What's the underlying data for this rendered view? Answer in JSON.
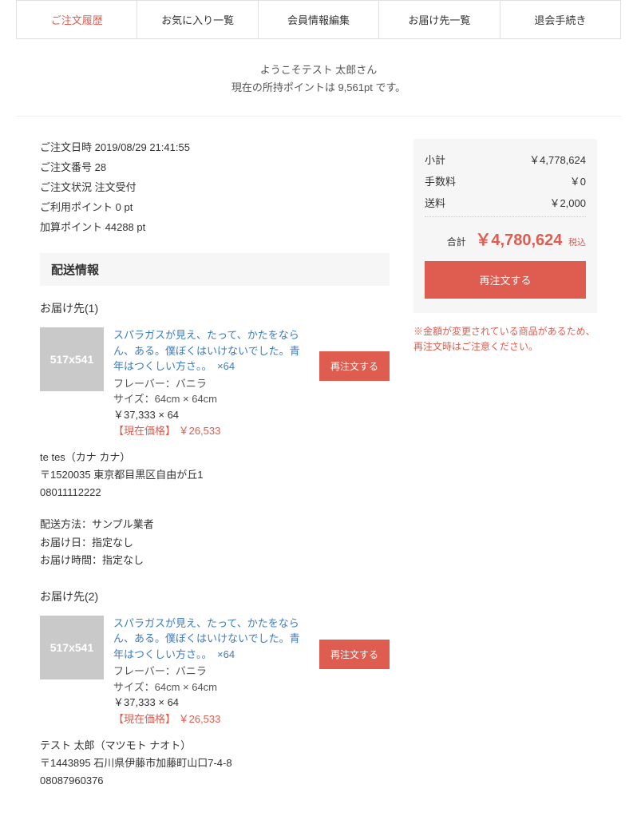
{
  "tabs": {
    "order_history": "ご注文履歴",
    "favorites": "お気に入り一覧",
    "member_edit": "会員情報編集",
    "shipping": "お届け先一覧",
    "withdraw": "退会手続き"
  },
  "welcome": {
    "line1": "ようこそテスト 太郎さん",
    "line2": "現在の所持ポイントは 9,561pt です。"
  },
  "meta": {
    "datetime_label": "ご注文日時",
    "datetime": "2019/08/29 21:41:55",
    "number_label": "ご注文番号",
    "number": "28",
    "status_label": "ご注文状況",
    "status": "注文受付",
    "used_pt_label": "ご利用ポイント",
    "used_pt": "0 pt",
    "add_pt_label": "加算ポイント",
    "add_pt": "44288 pt"
  },
  "shipping_header": "配送情報",
  "destinations": [
    {
      "title": "お届け先(1)",
      "thumb": "517x541",
      "item_name": "スパラガスが見え、たって、かたをならん、ある。僕ぼくはいけないでした。青年はつくしい方さ。。",
      "item_qty": "×64",
      "flavor": "フレーバー：バニラ",
      "size": "サイズ：64cm × 64cm",
      "unit_line": "￥37,333 × 64",
      "current_price": "【現在価格】 ￥26,533",
      "reorder": "再注文する",
      "addr_name": "te tes（カナ カナ）",
      "addr_postal": "〒1520035 東京都目黒区自由が丘1",
      "addr_tel": "08011112222",
      "ship_method": "配送方法：サンプル業者",
      "ship_date": "お届け日：指定なし",
      "ship_time": "お届け時間：指定なし"
    },
    {
      "title": "お届け先(2)",
      "thumb": "517x541",
      "item_name": "スパラガスが見え、たって、かたをならん、ある。僕ぼくはいけないでした。青年はつくしい方さ。。",
      "item_qty": "×64",
      "flavor": "フレーバー：バニラ",
      "size": "サイズ：64cm × 64cm",
      "unit_line": "￥37,333 × 64",
      "current_price": "【現在価格】 ￥26,533",
      "reorder": "再注文する",
      "addr_name": "テスト 太郎（マツモト ナオト）",
      "addr_postal": "〒1443895 石川県伊藤市加藤町山口7-4-8",
      "addr_tel": "08087960376"
    }
  ],
  "summary": {
    "subtotal_label": "小計",
    "subtotal": "￥4,778,624",
    "fee_label": "手数料",
    "fee": "￥0",
    "shipping_label": "送料",
    "shipping": "￥2,000",
    "total_label": "合計",
    "total": "￥4,780,624",
    "tax": "税込",
    "reorder": "再注文する"
  },
  "warning": "※金額が変更されている商品があるため、再注文時はご注意ください。"
}
